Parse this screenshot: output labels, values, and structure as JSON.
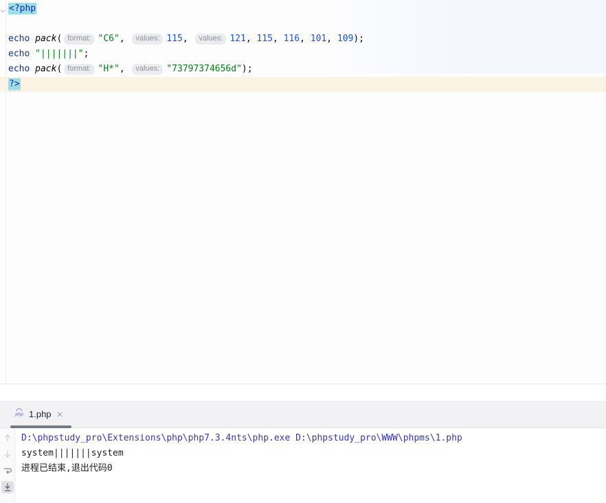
{
  "editor": {
    "language": "php",
    "lines": [
      {
        "caret": false,
        "tokens": [
          {
            "c": "tag",
            "t": "<?php"
          }
        ]
      },
      {
        "caret": false,
        "tokens": []
      },
      {
        "caret": false,
        "tokens": [
          {
            "c": "kw",
            "t": "echo"
          },
          {
            "c": "pl",
            "t": " "
          },
          {
            "c": "fn",
            "t": "pack"
          },
          {
            "c": "pl",
            "t": "("
          },
          {
            "c": "hint",
            "t": "format:"
          },
          {
            "c": "str",
            "t": "\"C6\""
          },
          {
            "c": "pl",
            "t": ", "
          },
          {
            "c": "hint",
            "t": "values:"
          },
          {
            "c": "num",
            "t": "115"
          },
          {
            "c": "pl",
            "t": ", "
          },
          {
            "c": "hint",
            "t": "values:"
          },
          {
            "c": "num",
            "t": "121"
          },
          {
            "c": "pl",
            "t": ", "
          },
          {
            "c": "num",
            "t": "115"
          },
          {
            "c": "pl",
            "t": ", "
          },
          {
            "c": "num",
            "t": "116"
          },
          {
            "c": "pl",
            "t": ", "
          },
          {
            "c": "num",
            "t": "101"
          },
          {
            "c": "pl",
            "t": ", "
          },
          {
            "c": "num",
            "t": "109"
          },
          {
            "c": "pl",
            "t": ");"
          }
        ]
      },
      {
        "caret": false,
        "tokens": [
          {
            "c": "kw",
            "t": "echo"
          },
          {
            "c": "pl",
            "t": " "
          },
          {
            "c": "str",
            "t": "\"|||||||\""
          },
          {
            "c": "pl",
            "t": ";"
          }
        ]
      },
      {
        "caret": false,
        "tokens": [
          {
            "c": "kw",
            "t": "echo"
          },
          {
            "c": "pl",
            "t": " "
          },
          {
            "c": "fn",
            "t": "pack"
          },
          {
            "c": "pl",
            "t": "("
          },
          {
            "c": "hint",
            "t": "format:"
          },
          {
            "c": "str",
            "t": "\"H*\""
          },
          {
            "c": "pl",
            "t": ", "
          },
          {
            "c": "hint",
            "t": "values:"
          },
          {
            "c": "str",
            "t": "\"73797374656d\""
          },
          {
            "c": "pl",
            "t": ");"
          }
        ]
      },
      {
        "caret": true,
        "tokens": [
          {
            "c": "tagw",
            "t": "?>"
          }
        ]
      }
    ]
  },
  "tool_window": {
    "tab": {
      "label": "1.php",
      "icon": "php-file-icon",
      "close_icon": "close-icon"
    }
  },
  "console": {
    "toolbar_icons": [
      {
        "name": "arrow-up-icon",
        "state": "disabled"
      },
      {
        "name": "arrow-down-icon",
        "state": "disabled"
      },
      {
        "name": "soft-wrap-icon",
        "state": "normal"
      },
      {
        "name": "scroll-to-end-icon",
        "state": "selected"
      }
    ],
    "lines": [
      {
        "c": "cmd",
        "t": "D:\\phpstudy_pro\\Extensions\\php\\php7.3.4nts\\php.exe D:\\phpstudy_pro\\WWW\\phpms\\1.php"
      },
      {
        "c": "out",
        "t": "system|||||||system"
      },
      {
        "c": "out",
        "t": "进程已结束,退出代码0"
      }
    ]
  },
  "colors": {
    "keyword": "#0033b3",
    "string": "#067d17",
    "number": "#1750eb",
    "php_tag_highlight": "#a2dce5",
    "caret_row": "#fbf4e4",
    "parameter_hint_bg": "#ebecf0",
    "console_command": "#3636bb",
    "active_tab_underline": "#757b85",
    "php_icon_purple": "#8186e2"
  }
}
